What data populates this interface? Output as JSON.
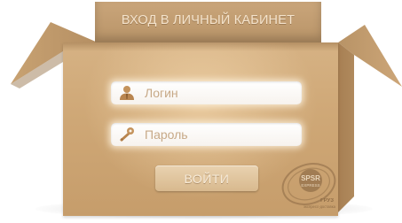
{
  "box": {
    "title": "ВХОД В ЛИЧНЫЙ КАБИНЕТ"
  },
  "form": {
    "login_placeholder": "Логин",
    "password_placeholder": "Пароль",
    "submit_label": "ВОЙТИ"
  },
  "icons": {
    "login": "user-icon",
    "password": "key-icon"
  },
  "logo": {
    "brand": "SPSR",
    "sub": "EXPRESS",
    "tagline_1": "ГРУЗ",
    "tagline_2": "экспресс-доставка"
  },
  "colors": {
    "cardboard": "#d2ad7d",
    "cardboard_dark": "#b99468",
    "field_bg": "#ffffff",
    "placeholder": "#c7a987",
    "button_bg": "#e3c9a3"
  }
}
